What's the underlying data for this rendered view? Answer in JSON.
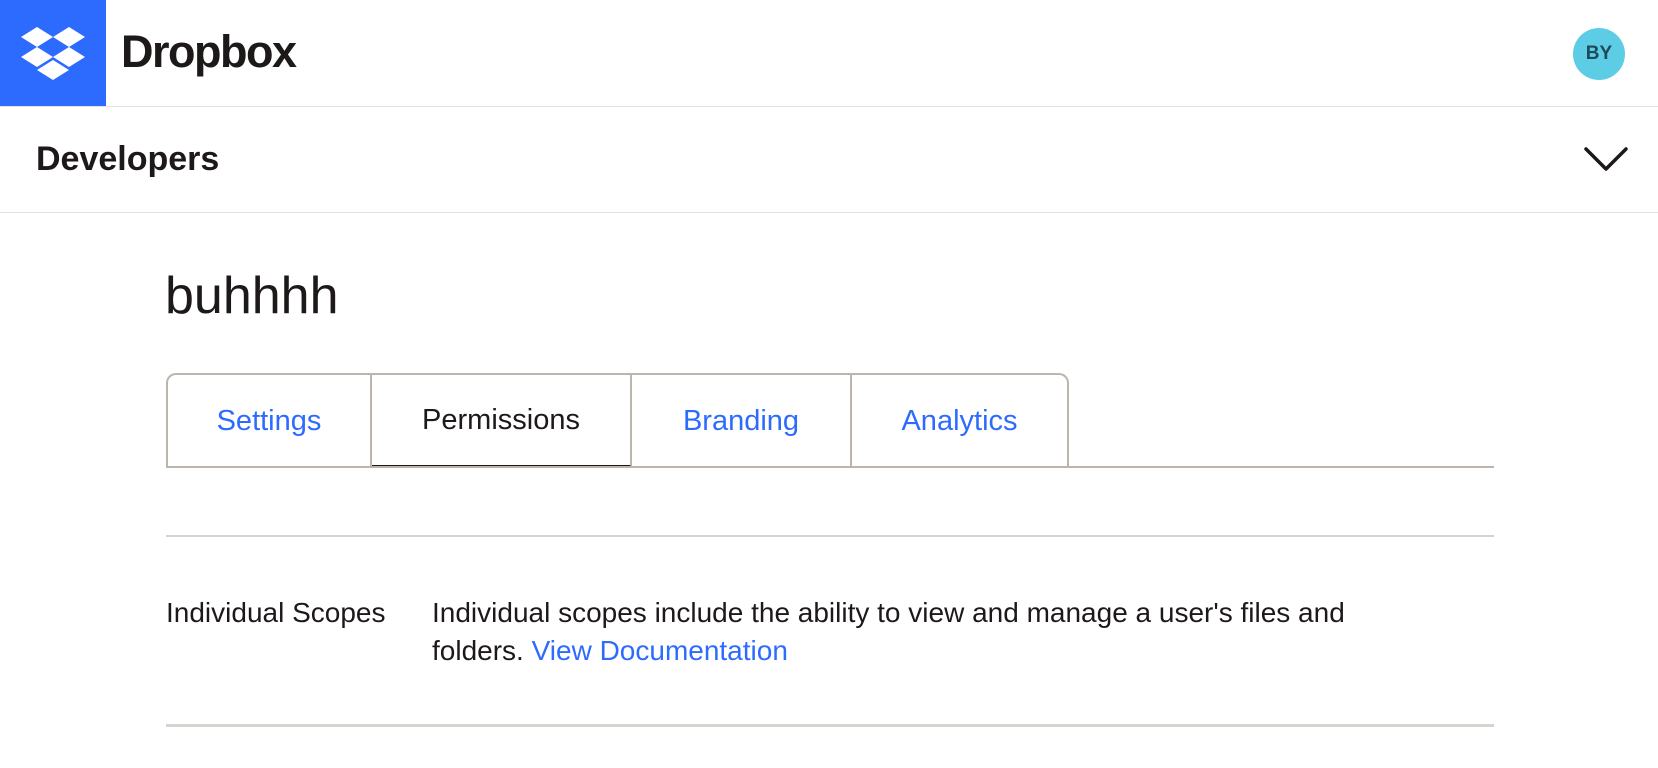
{
  "header": {
    "brand": "Dropbox",
    "logo_icon": "dropbox-logo-icon",
    "avatar_initials": "BY",
    "colors": {
      "brand_blue": "#2d6bff",
      "avatar_bg": "#5ccde5"
    }
  },
  "devbar": {
    "title": "Developers",
    "toggle_icon": "chevron-down-icon"
  },
  "app": {
    "name": "buhhhh"
  },
  "tabs": [
    {
      "label": "Settings",
      "active": false
    },
    {
      "label": "Permissions",
      "active": true
    },
    {
      "label": "Branding",
      "active": false
    },
    {
      "label": "Analytics",
      "active": false
    }
  ],
  "scopes": {
    "label": "Individual Scopes",
    "description": "Individual scopes include the ability to view and manage a user's files and folders.",
    "link_text": "View Documentation"
  }
}
